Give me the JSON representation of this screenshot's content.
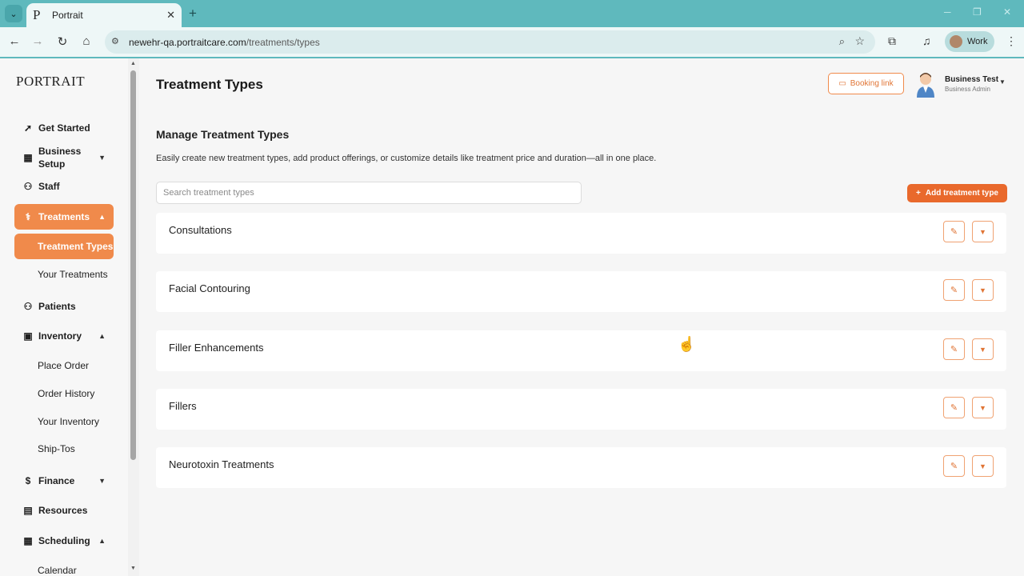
{
  "browser": {
    "tab_title": "Portrait",
    "favicon_letter": "P",
    "url_host": "newehr-qa.portraitcare.com",
    "url_path": "/treatments/types",
    "profile_label": "Work"
  },
  "sidebar": {
    "logo": "PORTRAIT",
    "items": {
      "get_started": "Get Started",
      "business_setup_line1": "Business",
      "business_setup_line2": "Setup",
      "staff": "Staff",
      "treatments": "Treatments",
      "treatment_types": "Treatment Types",
      "your_treatments": "Your Treatments",
      "patients": "Patients",
      "inventory": "Inventory",
      "place_order": "Place Order",
      "order_history": "Order History",
      "your_inventory": "Your Inventory",
      "ship_tos": "Ship-Tos",
      "finance": "Finance",
      "resources": "Resources",
      "scheduling": "Scheduling",
      "calendar": "Calendar"
    }
  },
  "header": {
    "title": "Treatment Types",
    "booking_link": "Booking link",
    "user_name": "Business Test",
    "user_role": "Business Admin"
  },
  "main": {
    "section_title": "Manage Treatment Types",
    "section_desc": "Easily create new treatment types, add product offerings, or customize details like treatment price and duration—all in one place.",
    "search_placeholder": "Search treatment types",
    "add_button": "Add treatment type",
    "treatment_types": [
      "Consultations",
      "Facial Contouring",
      "Filler Enhancements",
      "Fillers",
      "Neurotoxin Treatments"
    ]
  },
  "colors": {
    "brand_orange": "#f08a4b",
    "button_orange": "#e9692c",
    "browser_teal": "#5fb9bd"
  }
}
